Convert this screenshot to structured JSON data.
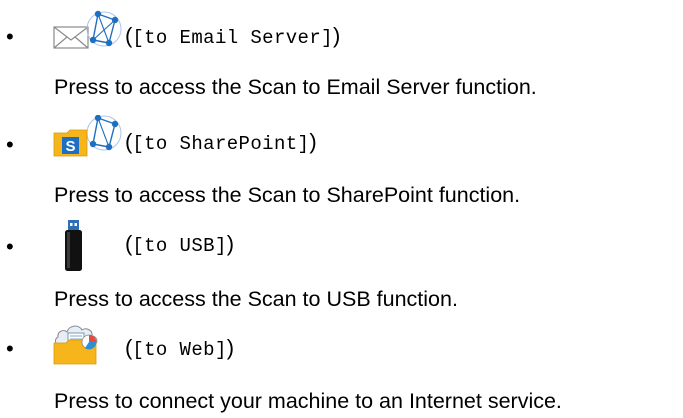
{
  "items": [
    {
      "icon": "email-server-icon",
      "label": "[to Email Server]",
      "description": "Press to access the Scan to Email Server function."
    },
    {
      "icon": "sharepoint-icon",
      "label": "[to SharePoint]",
      "description": "Press to access the Scan to SharePoint function."
    },
    {
      "icon": "usb-drive-icon",
      "label": "[to USB]",
      "description": "Press to access the Scan to USB function."
    },
    {
      "icon": "web-service-icon",
      "label": "[to Web]",
      "description": "Press to connect your machine to an Internet service."
    }
  ],
  "colors": {
    "network_blue": "#1f6fc0",
    "sharepoint_blue": "#1e6fc4",
    "folder_yellow": "#f5b51b",
    "usb_black": "#111111",
    "usb_cap_blue": "#2f6eb5"
  }
}
